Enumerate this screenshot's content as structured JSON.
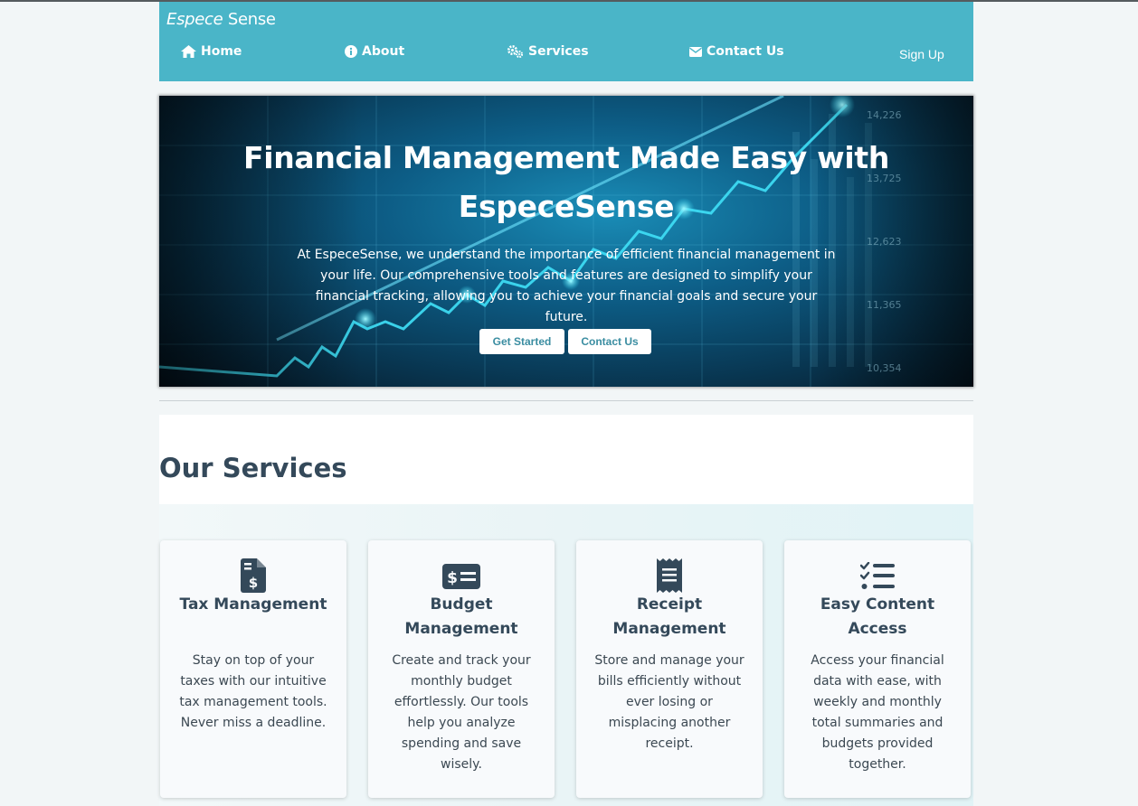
{
  "brand": {
    "part1": "Especе",
    "part2": " Sense"
  },
  "nav": {
    "home": "Home",
    "about": "About",
    "services": "Services",
    "contact": "Contact Us",
    "signup": "Sign Up"
  },
  "hero": {
    "title": "Financial Management Made Easy with EspeceSense",
    "text": "At EspeceSense, we understand the importance of efficient financial management in your life. Our comprehensive tools and features are designed to simplify your financial tracking, allowing you to achieve your financial goals and secure your future.",
    "btn_start": "Get Started",
    "btn_contact": "Contact Us",
    "axis_values": [
      "14,226",
      "13,725",
      "12,623",
      "11,365",
      "10,354"
    ]
  },
  "services": {
    "title": "Our Services",
    "cards": [
      {
        "icon": "tax-document-icon",
        "title": "Tax Management",
        "text": "Stay on top of your taxes with our intuitive tax management tools. Never miss a deadline."
      },
      {
        "icon": "money-bill-icon",
        "title": "Budget Management",
        "text": "Create and track your monthly budget effortlessly. Our tools help you analyze spending and save wisely."
      },
      {
        "icon": "receipt-icon",
        "title": "Receipt Management",
        "text": "Store and manage your bills efficiently without ever losing or misplacing another receipt."
      },
      {
        "icon": "checklist-icon",
        "title": "Easy Content Access",
        "text": "Access your financial data with ease, with weekly and monthly total summaries and budgets provided together."
      }
    ]
  },
  "colors": {
    "navbar": "#4ab5c8",
    "heading": "#34495a",
    "button_text": "#3a8da1"
  }
}
